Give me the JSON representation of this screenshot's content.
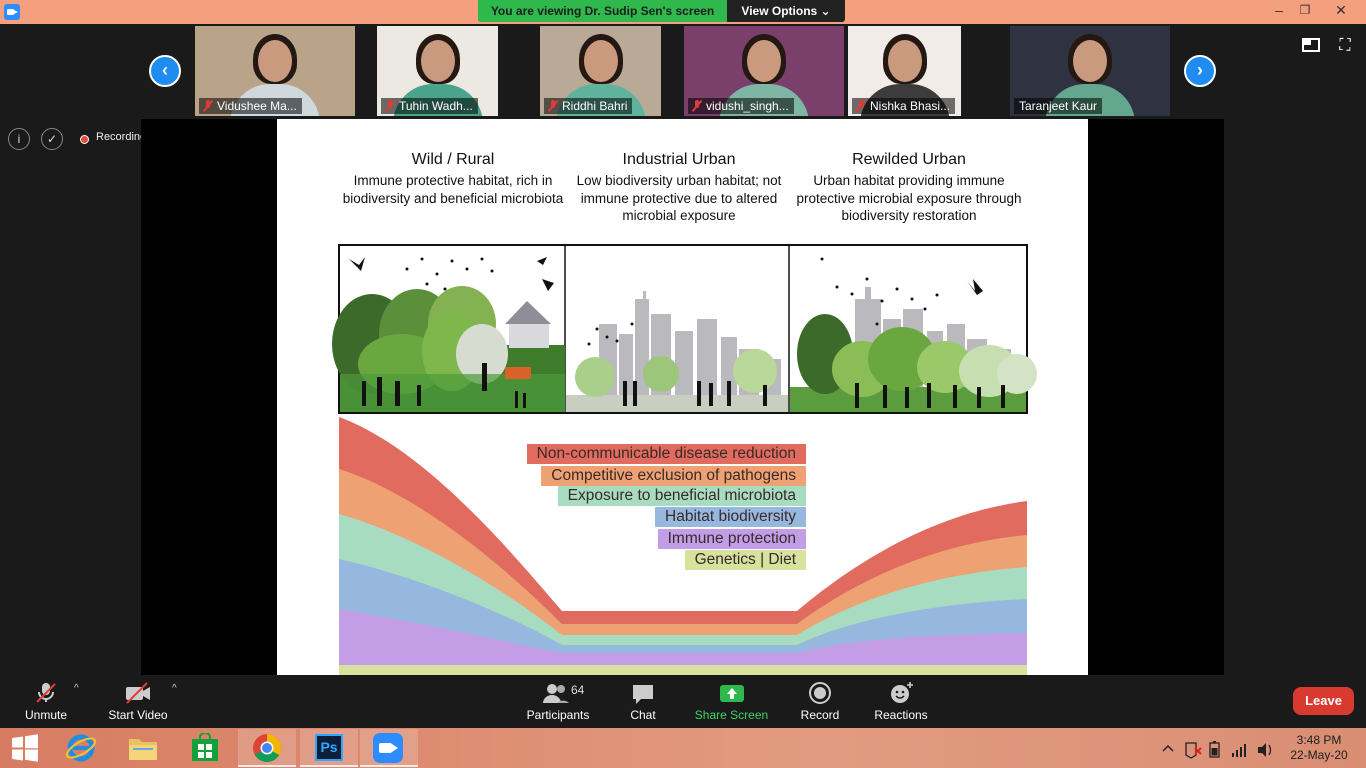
{
  "window": {
    "banner_text": "You are viewing Dr. Sudip Sen's screen",
    "view_options": "View Options ⌄",
    "minimize": "–",
    "maximize": "❐",
    "close": "✕"
  },
  "gallery": {
    "participants": [
      {
        "name": "Vidushee Ma...",
        "muted": true,
        "bg": "#b9a489",
        "shirt": "#cfd8dc"
      },
      {
        "name": "Tuhin Wadh...",
        "muted": true,
        "bg": "#ece8e2",
        "shirt": "#4aa38b"
      },
      {
        "name": "Riddhi Bahri",
        "muted": true,
        "bg": "#b8aa96",
        "shirt": "#5fb39c"
      },
      {
        "name": "vidushi_singh...",
        "muted": true,
        "bg": "#7a3f6a",
        "shirt": "#7fb5a5"
      },
      {
        "name": "Nishka Bhasi...",
        "muted": true,
        "bg": "#f1ece8",
        "shirt": "#3c3c3c"
      },
      {
        "name": "Taranjeet Kaur",
        "muted": false,
        "bg": "#2f3341",
        "shirt": "#63a88e"
      }
    ],
    "prev_arrow": "‹",
    "next_arrow": "›",
    "fullscreen_icon": "⛶"
  },
  "status": {
    "info_icon": "i",
    "shield_icon": "✓",
    "recording_text": "Recording"
  },
  "slide": {
    "columns": [
      {
        "title": "Wild / Rural",
        "desc": "Immune protective habitat, rich in biodiversity and beneficial microbiota"
      },
      {
        "title": "Industrial Urban",
        "desc": "Low biodiversity urban habitat; not immune protective due to altered microbial exposure"
      },
      {
        "title": "Rewilded Urban",
        "desc": "Urban habitat providing immune protective microbial exposure through biodiversity restoration"
      }
    ],
    "legend": [
      {
        "label": "Non-communicable disease reduction",
        "color": "#e06b5e"
      },
      {
        "label": "Competitive exclusion of pathogens",
        "color": "#eea172"
      },
      {
        "label": "Exposure to beneficial microbiota",
        "color": "#a8dcc1"
      },
      {
        "label": "Habitat biodiversity",
        "color": "#96b8de"
      },
      {
        "label": "Immune protection",
        "color": "#c39ee6"
      },
      {
        "label": "Genetics | Diet",
        "color": "#d6e29e"
      }
    ]
  },
  "toolbar": {
    "unmute": "Unmute",
    "start_video": "Start Video",
    "participants": "Participants",
    "participants_count": "64",
    "chat": "Chat",
    "share_screen": "Share Screen",
    "record": "Record",
    "reactions": "Reactions",
    "leave": "Leave",
    "caret": "^"
  },
  "taskbar": {
    "time": "3:48 PM",
    "date": "22-May-20",
    "apps": [
      "windows-start",
      "internet-explorer",
      "file-explorer",
      "store",
      "chrome",
      "photoshop",
      "zoom"
    ],
    "photoshop_label": "Ps"
  },
  "colors": {
    "zoom_blue": "#2d8cff",
    "banner_green": "#2fb84c",
    "leave_red": "#d93a2f",
    "title_bar": "#f4a07e"
  }
}
